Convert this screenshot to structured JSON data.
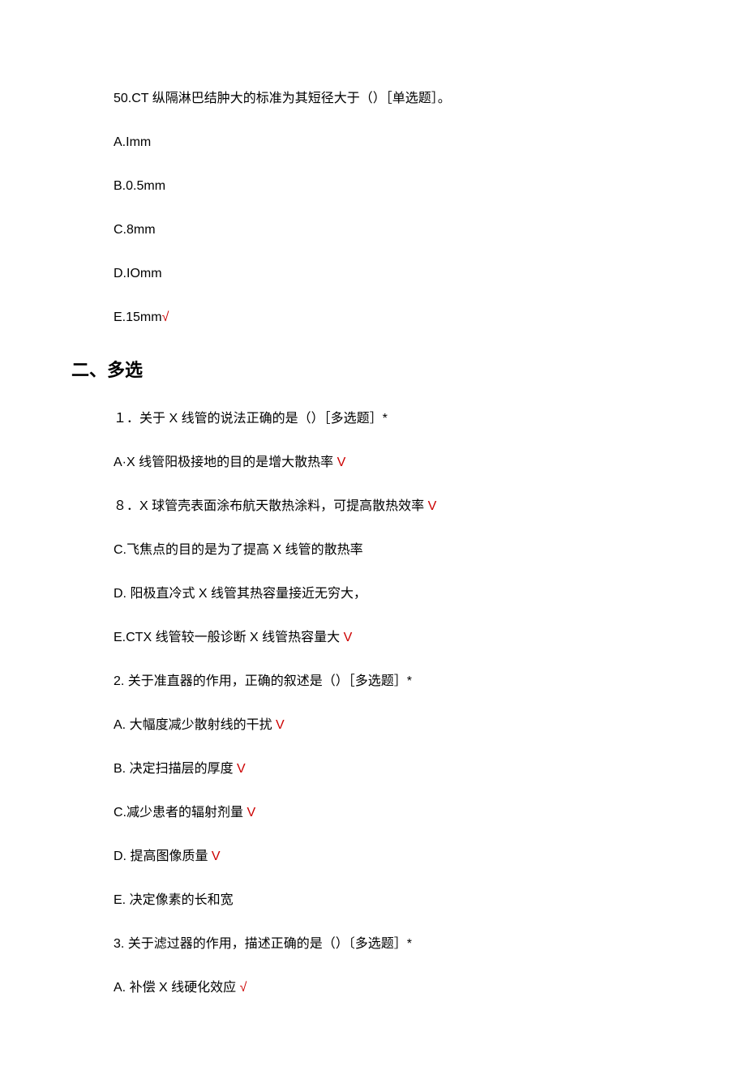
{
  "q50": {
    "stem": "50.CT 纵隔淋巴结肿大的标准为其短径大于（）［单选题］。",
    "a": "A.Imm",
    "b": "B.0.5mm",
    "c": "C.8mm",
    "d": "D.IOmm",
    "e": "E.15mm",
    "e_mark": "√"
  },
  "section2_heading": "二、多选",
  "q1": {
    "stem": "１．关于 X 线管的说法正确的是（）［多选题］*",
    "a_text": "A·X 线管阳极接地的目的是增大散热率",
    "a_mark": " V",
    "b_text": "８．X 球管壳表面涂布航天散热涂料，可提高散热效率",
    "b_mark": " V",
    "c_text": "C.飞焦点的目的是为了提高 X 线管的散热率",
    "d_text": "D. 阳极直冷式 X 线管其热容量接近无穷大，",
    "e_text": "E.CTX 线管较一般诊断 X 线管热容量大",
    "e_mark": " V"
  },
  "q2": {
    "stem": "2. 关于准直器的作用，正确的叙述是（）［多选题］*",
    "a_text": "A. 大幅度减少散射线的干扰",
    "a_mark": " V",
    "b_text": "B. 决定扫描层的厚度",
    "b_mark": " V",
    "c_text": "C.减少患者的辐射剂量",
    "c_mark": " V",
    "d_text": "D. 提高图像质量",
    "d_mark": " V",
    "e_text": "E. 决定像素的长和宽"
  },
  "q3": {
    "stem": "3. 关于滤过器的作用，描述正确的是（）〔多选题］*",
    "a_text": "A. 补偿 X 线硬化效应 ",
    "a_mark": "√"
  }
}
